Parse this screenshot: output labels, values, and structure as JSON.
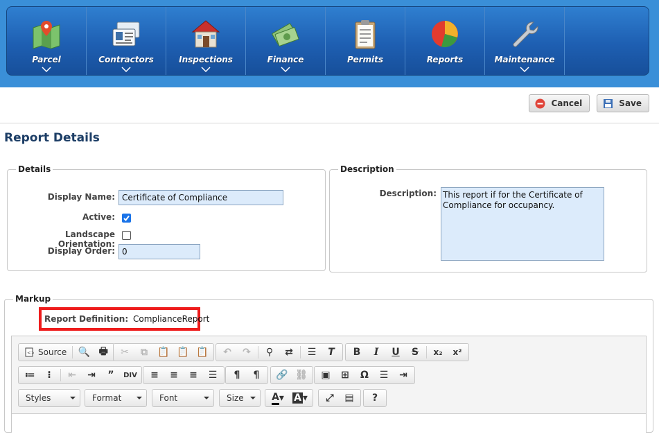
{
  "nav": {
    "items": [
      {
        "label": "Parcel",
        "icon": "map-pin-icon",
        "dropdown": true
      },
      {
        "label": "Contractors",
        "icon": "id-cards-icon",
        "dropdown": true
      },
      {
        "label": "Inspections",
        "icon": "house-icon",
        "dropdown": true
      },
      {
        "label": "Finance",
        "icon": "money-icon",
        "dropdown": true
      },
      {
        "label": "Permits",
        "icon": "clipboard-icon",
        "dropdown": false
      },
      {
        "label": "Reports",
        "icon": "pie-chart-icon",
        "dropdown": false
      },
      {
        "label": "Maintenance",
        "icon": "wrench-icon",
        "dropdown": true
      }
    ]
  },
  "toolbar": {
    "cancel_label": "Cancel",
    "save_label": "Save"
  },
  "page": {
    "title": "Report Details"
  },
  "details": {
    "legend": "Details",
    "display_name_label": "Display Name:",
    "display_name_value": "Certificate of Compliance",
    "active_label": "Active:",
    "active_checked": true,
    "landscape_label": "Landscape Orientation:",
    "landscape_checked": false,
    "display_order_label": "Display Order:",
    "display_order_value": "0"
  },
  "description": {
    "legend": "Description",
    "label": "Description:",
    "value": "This report if for the Certificate of Compliance for occupancy."
  },
  "markup": {
    "legend": "Markup",
    "report_definition_label": "Report Definition:",
    "report_definition_value": "ComplianceReport"
  },
  "editor": {
    "source_label": "Source",
    "styles_label": "Styles",
    "format_label": "Format",
    "font_label": "Font",
    "size_label": "Size"
  },
  "colors": {
    "nav_bg": "#1e5fb2",
    "page_bg": "#ffffff",
    "highlight": "#ee1c1c",
    "input_bg": "#dcebfb"
  }
}
